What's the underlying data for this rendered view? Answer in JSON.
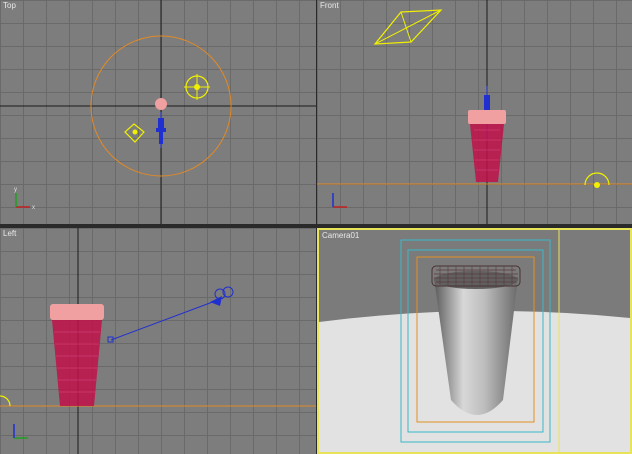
{
  "viewports": {
    "top": {
      "label": "Top"
    },
    "front": {
      "label": "Front"
    },
    "left": {
      "label": "Left"
    },
    "camera": {
      "label": "Camera01"
    }
  },
  "colors": {
    "viewport_bg": "#7d7d7d",
    "grid": "#6a6a6a",
    "axis_line": "#1a1a1a",
    "camera_object": "#2030d0",
    "light_object": "#f0f000",
    "range_circle": "#e08a28",
    "ground_line": "#e08a28",
    "cup_mesh": "#c0104a",
    "lid": "#f0a0a0",
    "active_border": "#e8e45a",
    "safe_frame_outer": "#38b8c8",
    "safe_frame_inner": "#e09020"
  }
}
